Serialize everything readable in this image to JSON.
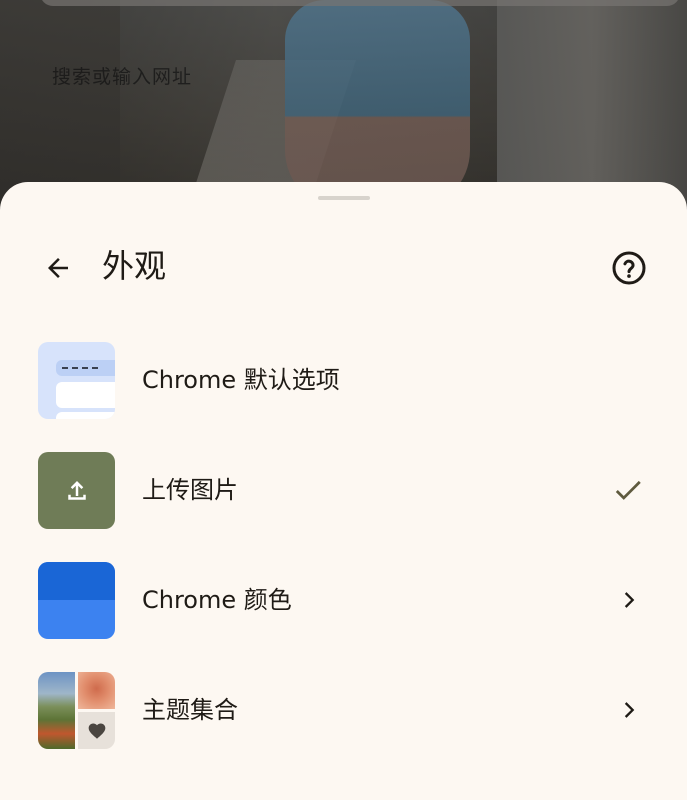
{
  "background": {
    "search_text": "搜索或输入网址"
  },
  "header": {
    "back_icon": "arrow-back-icon",
    "title": "外观",
    "help_icon": "help-circle-icon"
  },
  "items": [
    {
      "label": "Chrome 默认选项",
      "thumbnail": "chrome-default-preview",
      "trailing_icon": null
    },
    {
      "label": "上传图片",
      "thumbnail": "upload-icon",
      "trailing_icon": "check-icon",
      "selected": true
    },
    {
      "label": "Chrome 颜色",
      "thumbnail": "color-swatch",
      "trailing_icon": "chevron-right-icon"
    },
    {
      "label": "主题集合",
      "thumbnail": "theme-collage",
      "trailing_icon": "chevron-right-icon"
    }
  ],
  "colors": {
    "sheet_background": "#fdf8f2",
    "text_primary": "#1f1b16",
    "upload_tile": "#6f7c57",
    "chrome_blue_dark": "#1a66d6",
    "chrome_blue_light": "#3c82f0",
    "check": "#5f5a3e"
  }
}
